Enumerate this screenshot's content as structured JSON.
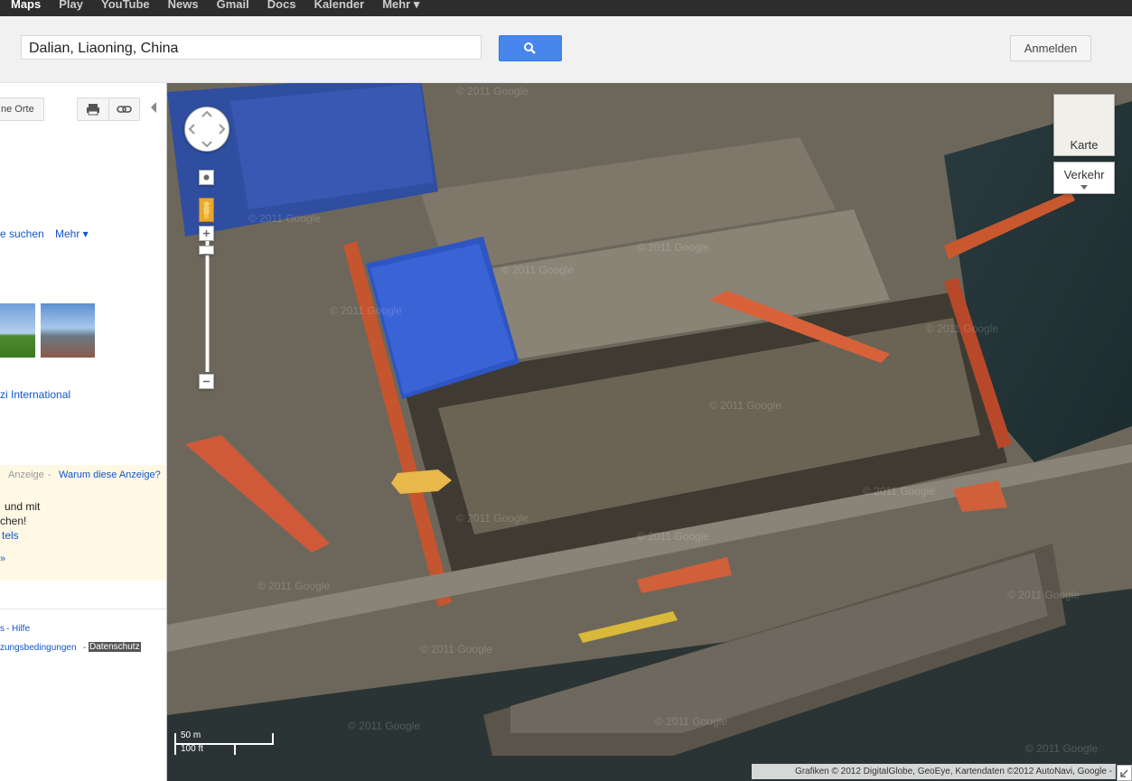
{
  "topbar": {
    "items": [
      "Maps",
      "Play",
      "YouTube",
      "News",
      "Gmail",
      "Docs",
      "Kalender",
      "Mehr ▾"
    ]
  },
  "search": {
    "value": "Dalian, Liaoning, China",
    "signin_label": "Anmelden"
  },
  "sidebar": {
    "my_places_label": "ne Orte",
    "nearby_label": "e suchen",
    "more_label": "Mehr ▾",
    "hotel_link": "zi International",
    "ad_label": "Anzeige",
    "ad_separator": "-",
    "ad_why": "Warum diese Anzeige?",
    "ad_line1": "und mit",
    "ad_line2": "chen!",
    "ad_line3": "tels",
    "ad_line4": "»",
    "footer_line1_a": "s",
    "footer_line1_sep": "-",
    "footer_help": "Hilfe",
    "footer_terms": "zungsbedingungen",
    "footer_sep2": "-",
    "footer_privacy": "Datenschutz"
  },
  "map": {
    "karte_label": "Karte",
    "traffic_label": "Verkehr",
    "scale_m": "50 m",
    "scale_ft": "100 ft",
    "attribution": "Grafiken © 2012 DigitalGlobe, GeoEye, Kartendaten ©2012 AutoNavi, Google -",
    "watermark": "© 2011 Google"
  }
}
